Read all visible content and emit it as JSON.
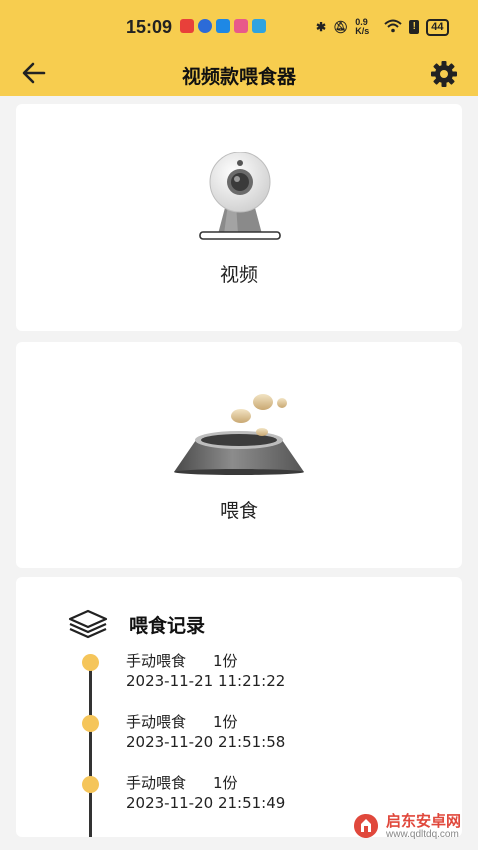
{
  "status_bar": {
    "time": "15:09",
    "battery": "44",
    "network_speed": "0.9 K/s",
    "app_colors": [
      "#e8403a",
      "#2c6bd8",
      "#1e88e5",
      "#e85a8a",
      "#2fa3e0"
    ]
  },
  "header": {
    "title": "视频款喂食器",
    "back_icon": "arrow-left-icon",
    "settings_icon": "gear-icon",
    "background_color": "#f7cd4f"
  },
  "video_card": {
    "label": "视频",
    "icon": "webcam-icon"
  },
  "feed_card": {
    "label": "喂食",
    "icon": "pet-bowl-icon"
  },
  "records": {
    "title": "喂食记录",
    "icon": "layers-icon",
    "accent_color": "#f5c55a",
    "items": [
      {
        "action": "手动喂食",
        "qty": "1份",
        "time": "2023-11-21 11:21:22"
      },
      {
        "action": "手动喂食",
        "qty": "1份",
        "time": "2023-11-20 21:51:58"
      },
      {
        "action": "手动喂食",
        "qty": "1份",
        "time": "2023-11-20 21:51:49"
      }
    ]
  },
  "watermark": {
    "title": "启东安卓网",
    "url": "www.qdltdq.com"
  }
}
